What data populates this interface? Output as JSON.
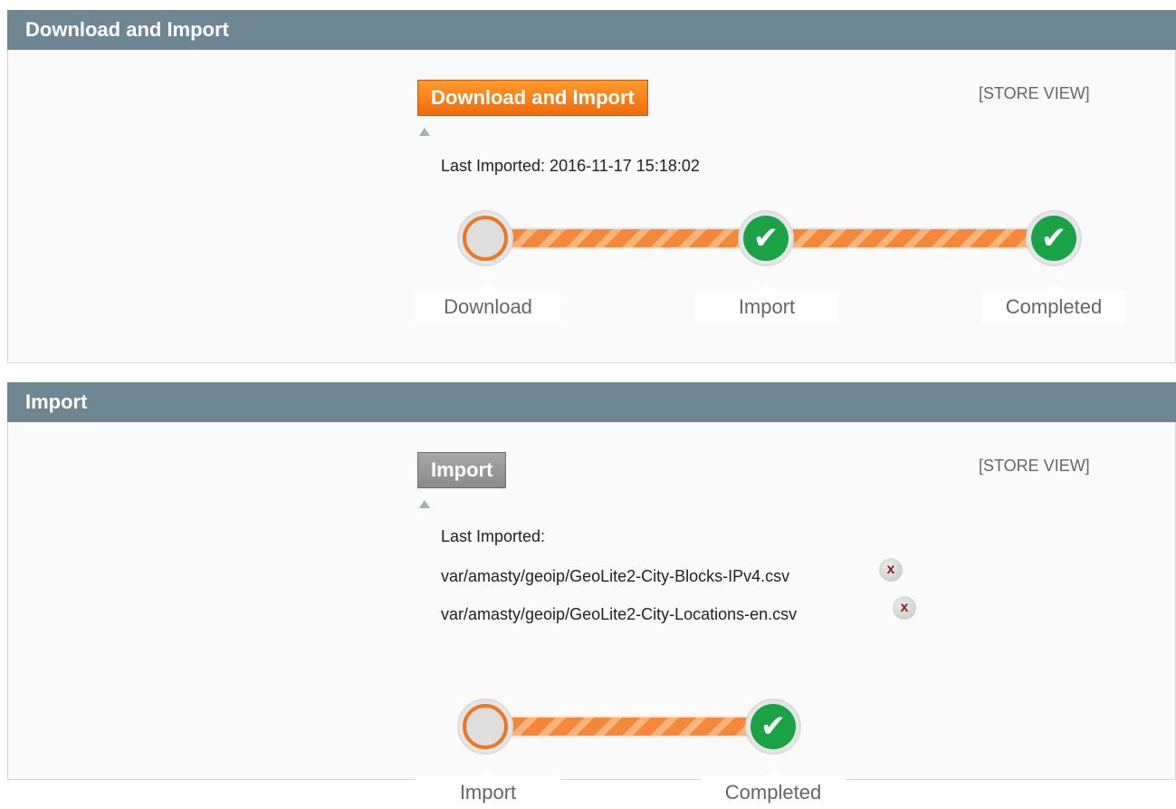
{
  "download_section": {
    "title": "Download and Import",
    "button_label": "Download and Import",
    "scope": "[STORE VIEW]",
    "last_imported": "Last Imported: 2016-11-17 15:18:02",
    "steps": [
      {
        "label": "Download",
        "status": "pending"
      },
      {
        "label": "Import",
        "status": "done"
      },
      {
        "label": "Completed",
        "status": "done"
      }
    ]
  },
  "import_section": {
    "title": "Import",
    "button_label": "Import",
    "scope": "[STORE VIEW]",
    "last_imported_label": "Last Imported:",
    "files": [
      {
        "path": "var/amasty/geoip/GeoLite2-City-Blocks-IPv4.csv",
        "remove_label": "x"
      },
      {
        "path": "var/amasty/geoip/GeoLite2-City-Locations-en.csv",
        "remove_label": "x"
      }
    ],
    "steps": [
      {
        "label": "Import",
        "status": "pending"
      },
      {
        "label": "Completed",
        "status": "done"
      }
    ]
  },
  "icons": {
    "check_glyph": "✔",
    "pending_icon": "circle-pending-icon",
    "done_icon": "check-circle-icon",
    "remove_icon": "remove-x-icon"
  },
  "colors": {
    "header_bg": "#6f8792",
    "accent_orange": "#f26b0a",
    "success_green": "#1aa345"
  }
}
